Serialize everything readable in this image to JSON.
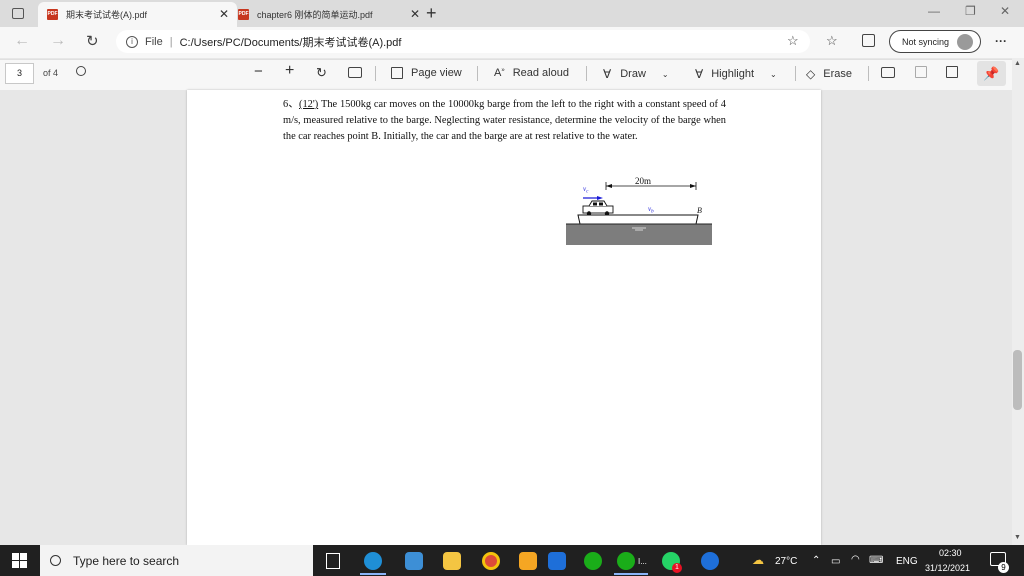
{
  "browser": {
    "tabs": [
      {
        "title": "期末考试试卷(A).pdf",
        "icon": "pdf-icon"
      },
      {
        "title": "chapter6 刚体的简单运动.pdf",
        "icon": "pdf-icon"
      }
    ],
    "address": {
      "prefix": "File",
      "url": "C:/Users/PC/Documents/期末考试试卷(A).pdf"
    },
    "sync_label": "Not syncing",
    "more": "···"
  },
  "pdf_toolbar": {
    "page_current": "3",
    "page_total": "of 4",
    "page_view": "Page view",
    "read_aloud": "Read aloud",
    "draw": "Draw",
    "highlight": "Highlight",
    "erase": "Erase"
  },
  "document": {
    "problem_number": "6、",
    "problem_points": "(12')",
    "problem_text": " The 1500kg car moves on the 10000kg barge from the left to the right with a constant speed of 4 m/s, measured relative to the barge. Neglecting water resistance, determine the velocity of the barge when the car reaches point B. Initially, the car and the barge are at rest relative to the water.",
    "figure": {
      "distance_label": "20m",
      "car_velocity_label": "v",
      "car_velocity_sub": "c",
      "barge_velocity_label": "v",
      "barge_velocity_sub": "b",
      "point_label": "B"
    }
  },
  "taskbar": {
    "search_placeholder": "Type here to search",
    "weather": "27°C",
    "language": "ENG",
    "time": "02:30",
    "date": "31/12/2021",
    "notification_count": "9",
    "whatsapp_badge": "1",
    "wechat_label": "I..."
  },
  "colors": {
    "accent": "#0078d4",
    "pdf_red": "#c7371f",
    "arrow_blue": "#1a1ad8"
  }
}
